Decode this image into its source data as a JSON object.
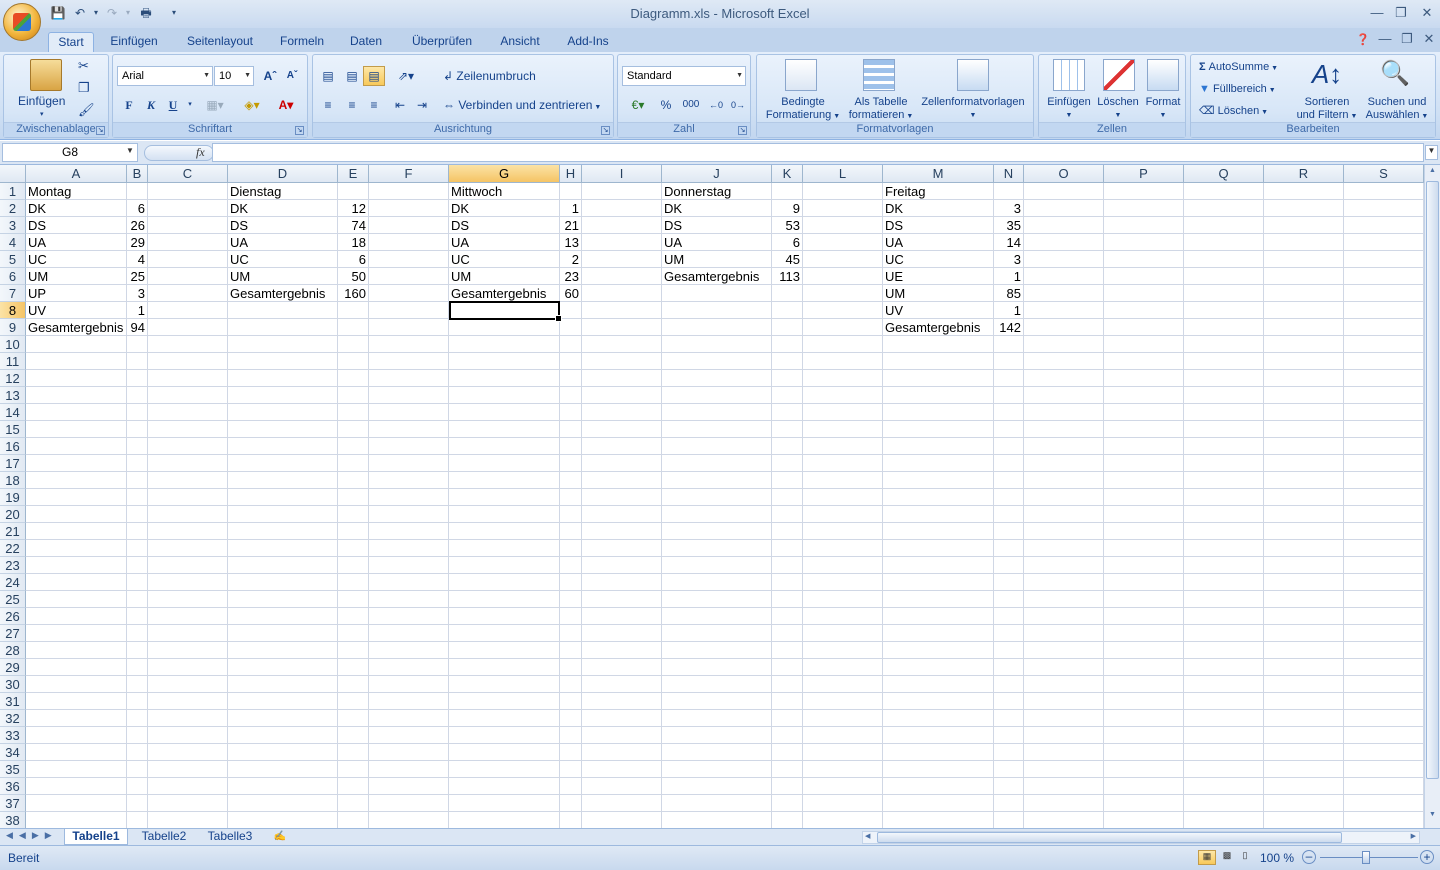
{
  "window": {
    "title": "Diagramm.xls - Microsoft Excel"
  },
  "tabs": [
    "Start",
    "Einfügen",
    "Seitenlayout",
    "Formeln",
    "Daten",
    "Überprüfen",
    "Ansicht",
    "Add-Ins"
  ],
  "ribbon": {
    "clipboard": {
      "paste": "Einfügen",
      "label": "Zwischenablage"
    },
    "font": {
      "family": "Arial",
      "size": "10",
      "bold": "F",
      "italic": "K",
      "underline": "U",
      "label": "Schriftart"
    },
    "alignment": {
      "wrap": "Zeilenumbruch",
      "merge": "Verbinden und zentrieren",
      "label": "Ausrichtung"
    },
    "number": {
      "format": "Standard",
      "percent": "%",
      "thousands": "000",
      "label": "Zahl"
    },
    "styles": {
      "conditional1": "Bedingte",
      "conditional2": "Formatierung",
      "table1": "Als Tabelle",
      "table2": "formatieren",
      "cellstyles": "Zellenformatvorlagen",
      "label": "Formatvorlagen"
    },
    "cells": {
      "insert": "Einfügen",
      "delete": "Löschen",
      "format": "Format",
      "label": "Zellen"
    },
    "editing": {
      "autosum": "AutoSumme",
      "fill": "Füllbereich",
      "clear": "Löschen",
      "sort1": "Sortieren",
      "sort2": "und Filtern",
      "find1": "Suchen und",
      "find2": "Auswählen",
      "label": "Bearbeiten"
    }
  },
  "formula_bar": {
    "name_box": "G8",
    "fx": "fx",
    "value": ""
  },
  "columns": [
    "A",
    "B",
    "C",
    "D",
    "E",
    "F",
    "G",
    "H",
    "I",
    "J",
    "K",
    "L",
    "M",
    "N",
    "O",
    "P",
    "Q",
    "R",
    "S"
  ],
  "selected": {
    "column": "G",
    "row": "8"
  },
  "rows": [
    "1",
    "2",
    "3",
    "4",
    "5",
    "6",
    "7",
    "8",
    "9",
    "10",
    "11",
    "12",
    "13",
    "14",
    "15",
    "16",
    "17",
    "18",
    "19",
    "20",
    "21",
    "22",
    "23",
    "24",
    "25",
    "26",
    "27",
    "28",
    "29",
    "30",
    "31",
    "32",
    "33",
    "34",
    "35",
    "36",
    "37",
    "38"
  ],
  "cells": {
    "A1": "Montag",
    "A2": "DK",
    "B2": "6",
    "A3": "DS",
    "B3": "26",
    "A4": "UA",
    "B4": "29",
    "A5": "UC",
    "B5": "4",
    "A6": "UM",
    "B6": "25",
    "A7": "UP",
    "B7": "3",
    "A8": "UV",
    "B8": "1",
    "A9": "Gesamtergebnis",
    "B9": "94",
    "D1": "Dienstag",
    "D2": "DK",
    "E2": "12",
    "D3": "DS",
    "E3": "74",
    "D4": "UA",
    "E4": "18",
    "D5": "UC",
    "E5": "6",
    "D6": "UM",
    "E6": "50",
    "D7": "Gesamtergebnis",
    "E7": "160",
    "G1": "Mittwoch",
    "G2": "DK",
    "H2": "1",
    "G3": "DS",
    "H3": "21",
    "G4": "UA",
    "H4": "13",
    "G5": "UC",
    "H5": "2",
    "G6": "UM",
    "H6": "23",
    "G7": "Gesamtergebnis",
    "H7": "60",
    "J1": "Donnerstag",
    "J2": "DK",
    "K2": "9",
    "J3": "DS",
    "K3": "53",
    "J4": "UA",
    "K4": "6",
    "J5": "UM",
    "K5": "45",
    "J6": "Gesamtergebnis",
    "K6": "113",
    "M1": "Freitag",
    "M2": "DK",
    "N2": "3",
    "M3": "DS",
    "N3": "35",
    "M4": "UA",
    "N4": "14",
    "M5": "UC",
    "N5": "3",
    "M6": "UE",
    "N6": "1",
    "M7": "UM",
    "N7": "85",
    "M8": "UV",
    "N8": "1",
    "M9": "Gesamtergebnis",
    "N9": "142"
  },
  "sheets": [
    "Tabelle1",
    "Tabelle2",
    "Tabelle3"
  ],
  "active_sheet": "Tabelle1",
  "status": {
    "text": "Bereit",
    "zoom": "100 %"
  }
}
